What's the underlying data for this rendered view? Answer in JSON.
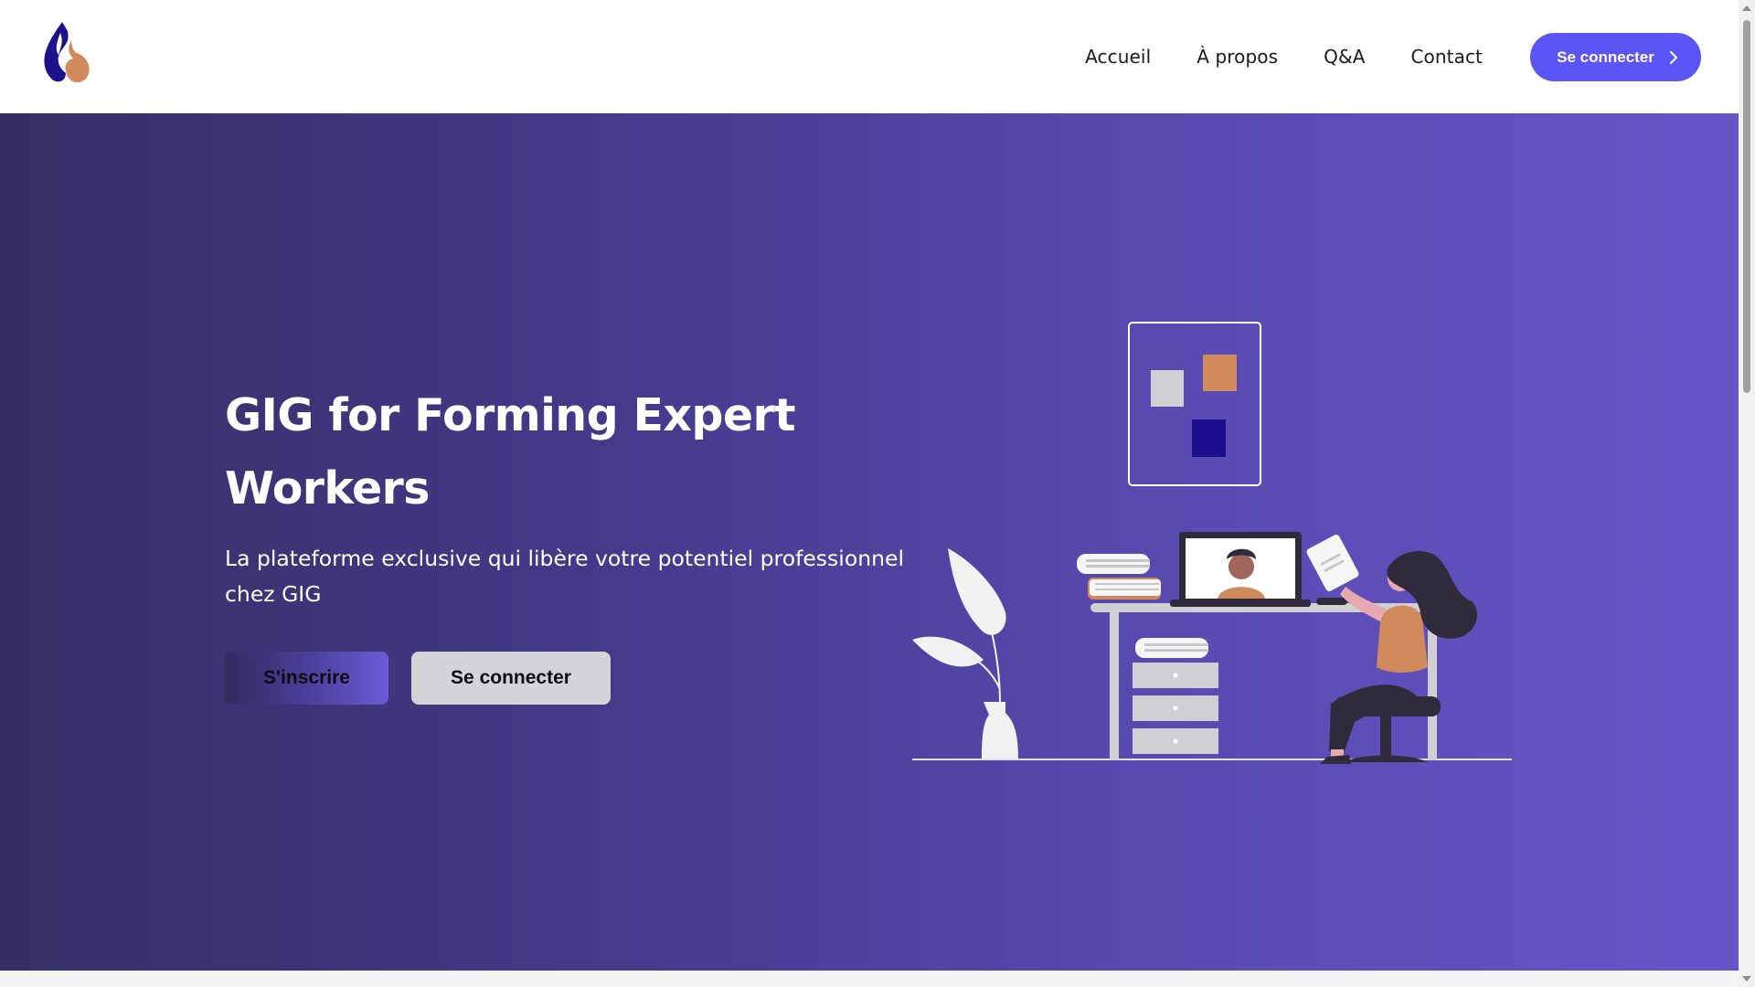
{
  "header": {
    "logo_icon": "drop-logo-icon",
    "nav": [
      {
        "label": "Accueil"
      },
      {
        "label": "À propos"
      },
      {
        "label": "Q&A"
      },
      {
        "label": "Contact"
      }
    ],
    "login_button": {
      "label": "Se connecter",
      "icon": "chevron-right-icon"
    }
  },
  "hero": {
    "title_line1": "GIG for Forming Expert",
    "title_line2": "Workers",
    "subtitle_line1": "La plateforme exclusive qui libère votre potentiel professionnel",
    "subtitle_line2": "chez GIG",
    "signup_label": "S'inscrire",
    "login_label": "Se connecter",
    "illustration": "woman-at-desk-video-call-illustration"
  },
  "colors": {
    "accent": "#5b55f5",
    "hero_gradient_start": "#352f64",
    "hero_gradient_end": "#6755c8",
    "logo_blue": "#1c138a",
    "logo_orange": "#d08a5c"
  }
}
